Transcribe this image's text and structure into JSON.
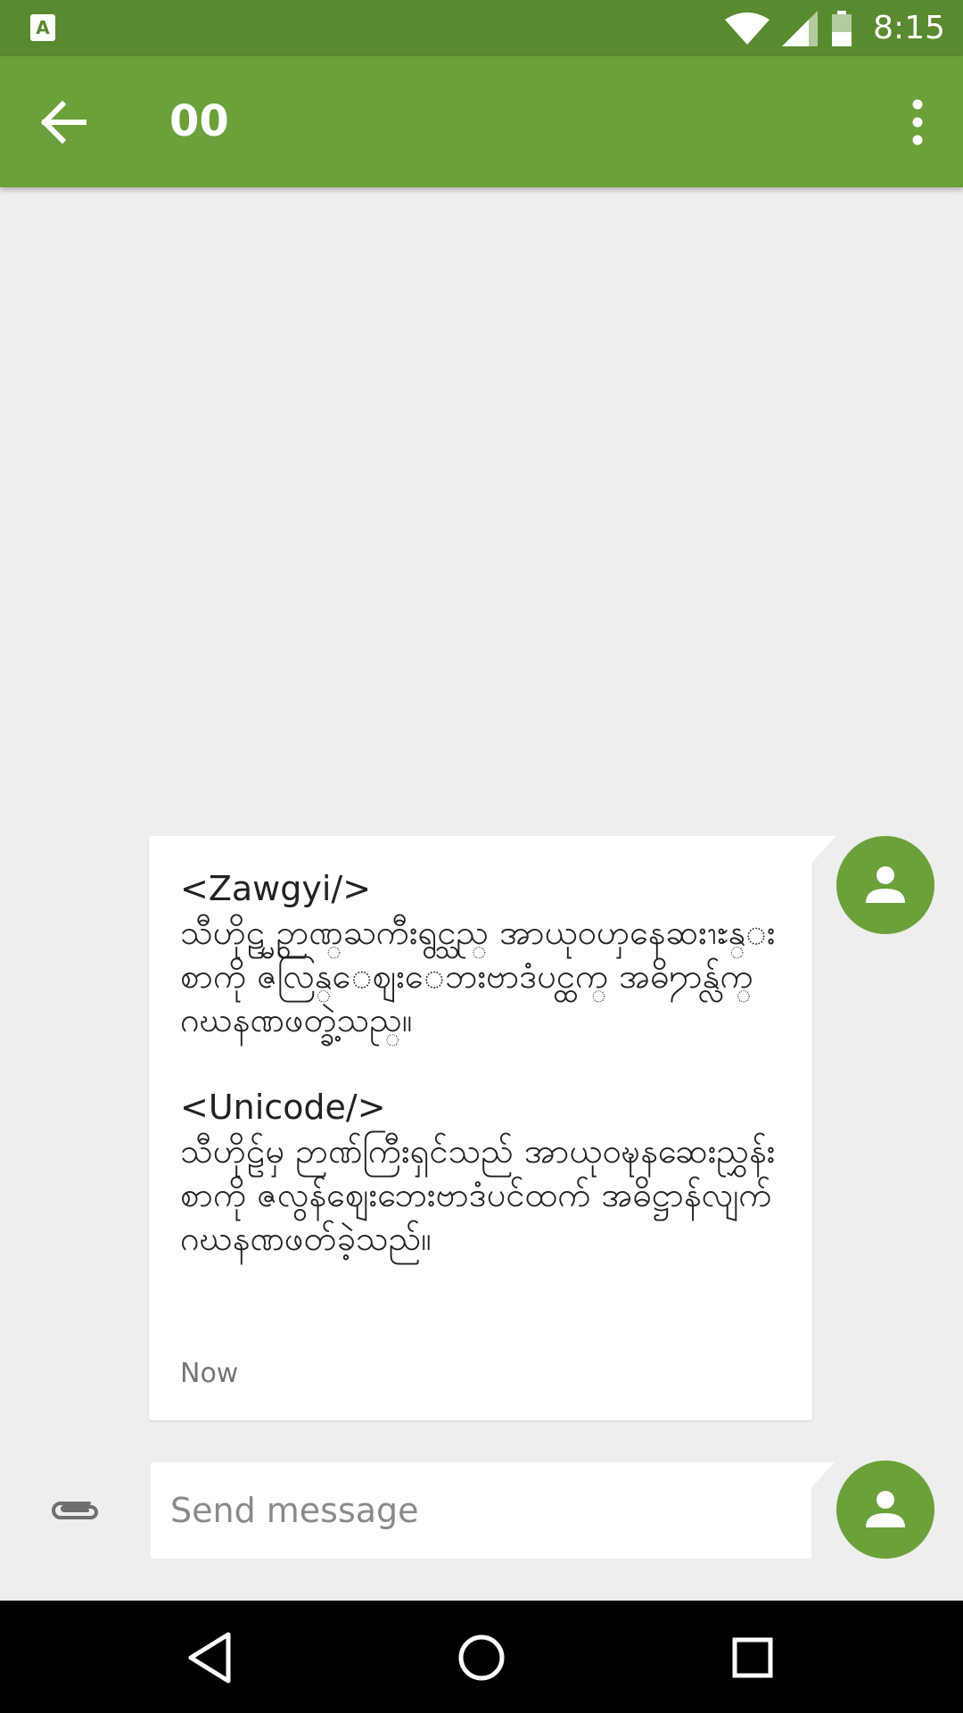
{
  "status_bar": {
    "time": "8:15",
    "app_icon_letter": "A",
    "icons": [
      "notification-app-icon",
      "wifi-icon",
      "cell-signal-icon",
      "battery-icon"
    ]
  },
  "app_bar": {
    "title": "00",
    "back_icon": "arrow-back-icon",
    "menu_icon": "more-vert-icon",
    "background_color": "#6ba03a",
    "status_color": "#5a8a30"
  },
  "conversation": {
    "message": {
      "text": "<Zawgyi/>\nသီဟိုဠ္မွ ဉာဏ္ႀကီးရွင္သည္ အာယုဝၯနေဆးၫႊန္းစာကို ဇလြန္ေဈးေဘးဗာဒံပင္ထက္ အဓိ႒ာန္လ်က္ ဂဃနဏဖတ္ခဲ့သည္။\n\n<Unicode/>\nသီဟိုဠ်မှ ဉာဏ်ကြီးရှင်သည် အာယုဝဍ္ဎနဆေးညွှန်းစာကို ဇလွန်ဈေးဘေးဗာဒံပင်ထက် အဓိဋ္ဌာန်လျက် ဂဃနဏဖတ်ခဲ့သည်။",
      "timestamp": "Now",
      "sender_avatar_icon": "person-icon"
    }
  },
  "compose": {
    "placeholder": "Send message",
    "value": "",
    "attach_icon": "paperclip-icon",
    "avatar_icon": "person-icon"
  },
  "nav_bar": {
    "buttons": [
      "back-triangle-icon",
      "home-circle-icon",
      "recents-square-icon"
    ]
  }
}
